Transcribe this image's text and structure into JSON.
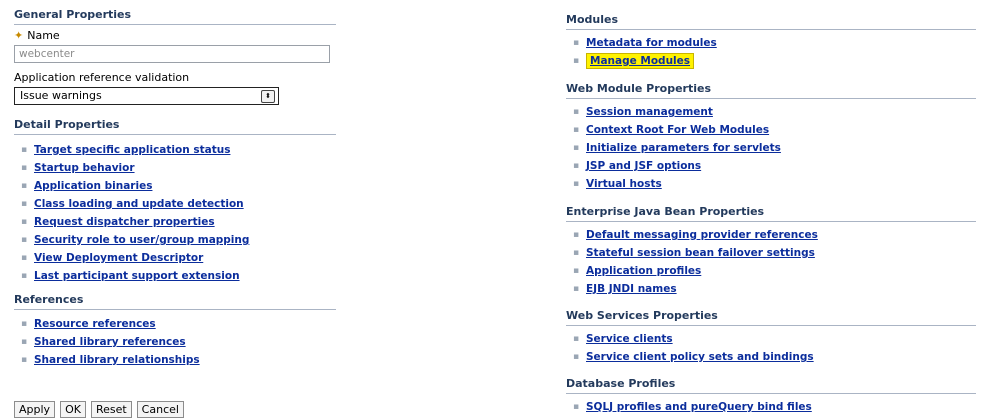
{
  "general": {
    "title": "General Properties",
    "name_label": "Name",
    "name_value": "webcenter",
    "validation_label": "Application reference validation",
    "validation_value": "Issue warnings"
  },
  "detail": {
    "title": "Detail Properties",
    "links": [
      "Target specific application status",
      "Startup behavior",
      "Application binaries",
      "Class loading and update detection",
      "Request dispatcher properties",
      "Security role to user/group mapping",
      "View Deployment Descriptor",
      "Last participant support extension"
    ]
  },
  "references": {
    "title": "References",
    "links": [
      "Resource references",
      "Shared library references",
      "Shared library relationships"
    ]
  },
  "buttons": {
    "apply": "Apply",
    "ok": "OK",
    "reset": "Reset",
    "cancel": "Cancel"
  },
  "modules": {
    "title": "Modules",
    "links": [
      "Metadata for modules",
      "Manage Modules"
    ],
    "highlighted": "Manage Modules"
  },
  "web_module": {
    "title": "Web Module Properties",
    "links": [
      "Session management",
      "Context Root For Web Modules",
      "Initialize parameters for servlets",
      "JSP and JSF options",
      "Virtual hosts"
    ]
  },
  "ejb": {
    "title": "Enterprise Java Bean Properties",
    "links": [
      "Default messaging provider references",
      "Stateful session bean failover settings",
      "Application profiles",
      "EJB JNDI names"
    ]
  },
  "web_services": {
    "title": "Web Services Properties",
    "links": [
      "Service clients",
      "Service client policy sets and bindings"
    ]
  },
  "database": {
    "title": "Database Profiles",
    "links": [
      "SQLJ profiles and pureQuery bind files"
    ]
  },
  "colors": {
    "link": "#0b2d9c",
    "highlight": "#fff200",
    "section_title": "#233a5c"
  }
}
